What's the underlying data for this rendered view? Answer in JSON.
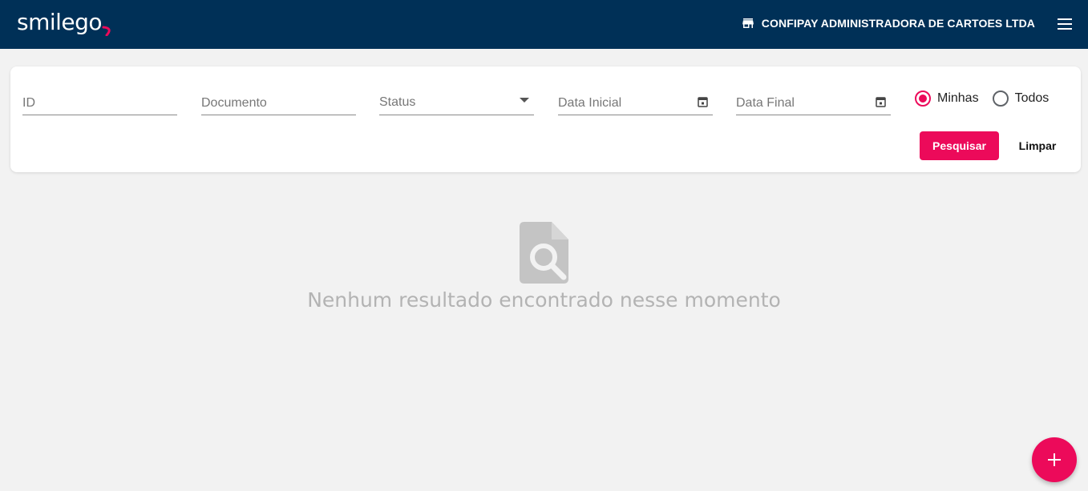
{
  "header": {
    "logo_text": "smilego",
    "company_name": "CONFIPAY ADMINISTRADORA DE CARTOES LTDA",
    "store_icon": "store-icon",
    "menu_icon": "hamburger-menu-icon"
  },
  "filters": {
    "id_placeholder": "ID",
    "documento_placeholder": "Documento",
    "status_label": "Status",
    "data_inicial_placeholder": "Data Inicial",
    "data_final_placeholder": "Data Final",
    "radio_options": [
      {
        "label": "Minhas",
        "checked": true
      },
      {
        "label": "Todos",
        "checked": false
      }
    ],
    "search_button": "Pesquisar",
    "clear_button": "Limpar"
  },
  "empty_state": {
    "icon": "search-document-icon",
    "message": "Nenhum resultado encontrado nesse momento"
  },
  "fab": {
    "icon": "plus-icon",
    "label": "+"
  },
  "colors": {
    "header_bg": "#003057",
    "accent": "#ec0a5a",
    "page_bg": "#f2f2f2",
    "empty_text": "#b3b3b3"
  }
}
